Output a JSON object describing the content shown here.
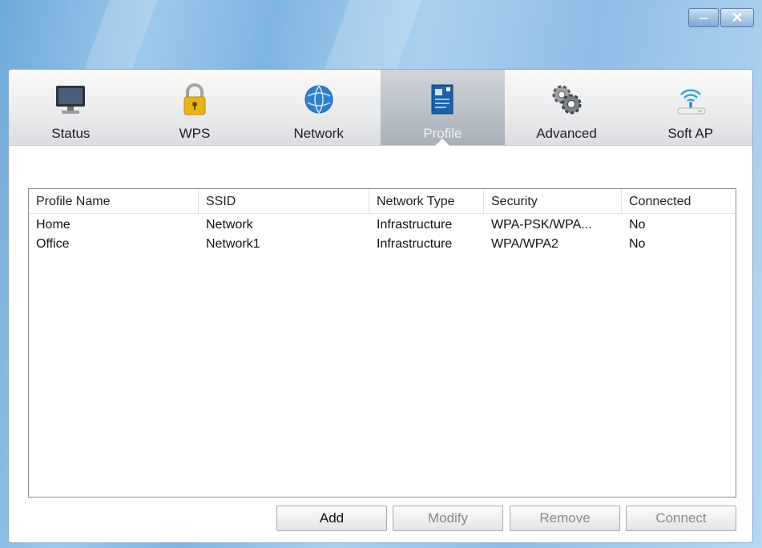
{
  "window": {
    "minimize_symbol": "‒",
    "close_symbol": "✕"
  },
  "tabs": [
    {
      "label": "Status",
      "icon": "monitor-icon"
    },
    {
      "label": "WPS",
      "icon": "padlock-icon"
    },
    {
      "label": "Network",
      "icon": "globe-icon"
    },
    {
      "label": "Profile",
      "icon": "profile-document-icon",
      "active": true
    },
    {
      "label": "Advanced",
      "icon": "gears-icon"
    },
    {
      "label": "Soft AP",
      "icon": "wireless-router-icon"
    }
  ],
  "profile_list": {
    "columns": [
      "Profile Name",
      "SSID",
      "Network Type",
      "Security",
      "Connected"
    ],
    "rows": [
      [
        "Home",
        "Network",
        "Infrastructure",
        "WPA-PSK/WPA...",
        "No"
      ],
      [
        "Office",
        "Network1",
        "Infrastructure",
        "WPA/WPA2",
        "No"
      ]
    ]
  },
  "buttons": {
    "add": "Add",
    "modify": "Modify",
    "remove": "Remove",
    "connect": "Connect"
  },
  "colors": {
    "active_tab": "#a9b0b8",
    "title_bar": "#8fbde6"
  }
}
